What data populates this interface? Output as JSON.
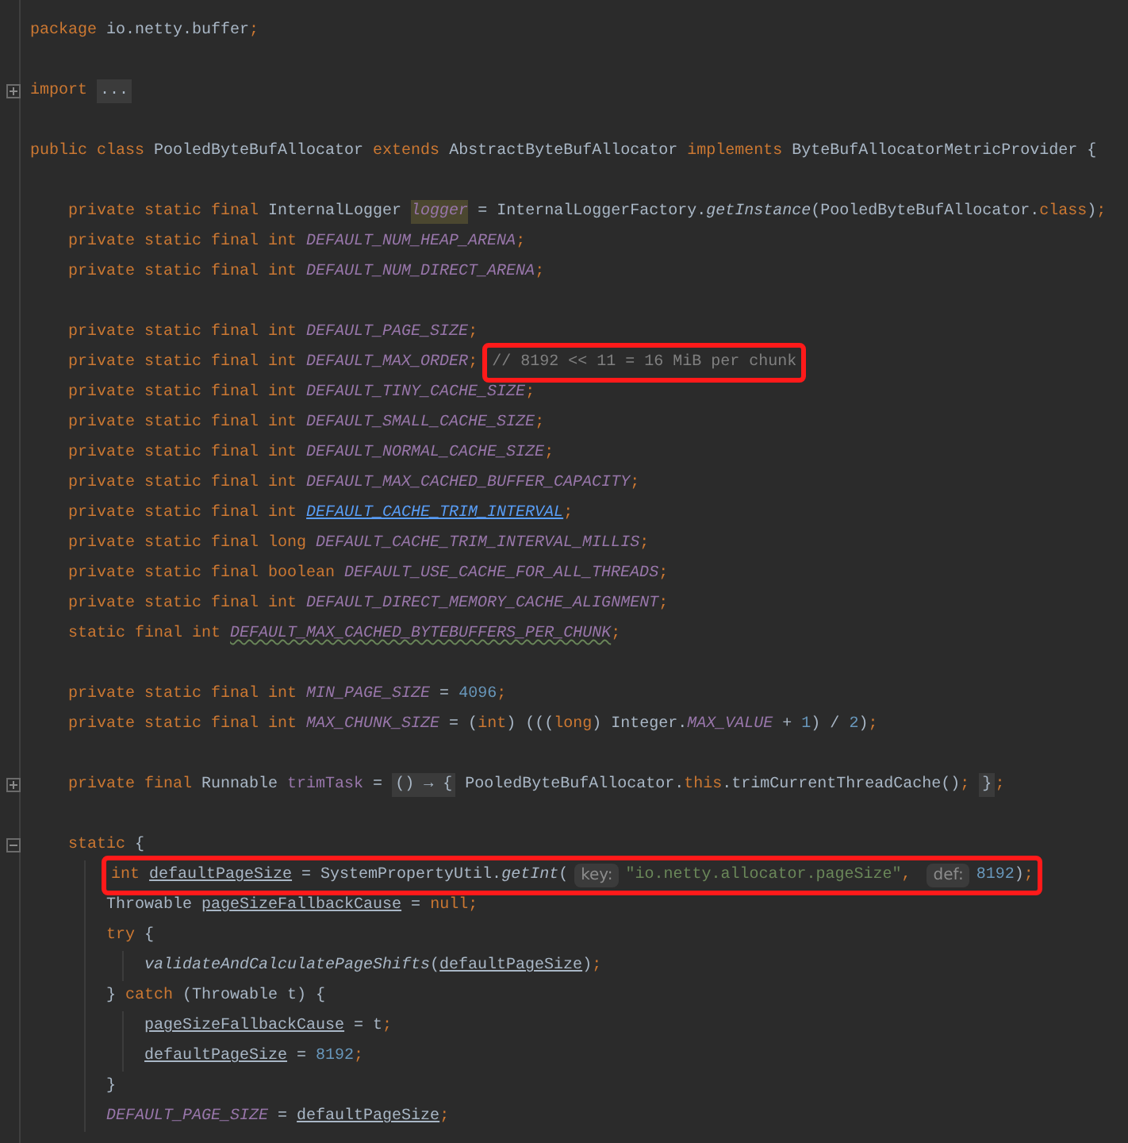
{
  "editor": {
    "lines": [
      {
        "kind": "code",
        "tokens": [
          {
            "kind": "kw",
            "text": "package "
          },
          {
            "kind": "plain",
            "text": "io.netty.buffer"
          },
          {
            "kind": "kw",
            "text": ";"
          }
        ]
      },
      {
        "kind": "blank"
      },
      {
        "kind": "code",
        "collapsed": true,
        "tokens": [
          {
            "kind": "kw",
            "text": "import "
          },
          {
            "kind": "folded",
            "text": "..."
          }
        ]
      },
      {
        "kind": "blank"
      },
      {
        "kind": "code",
        "tokens": [
          {
            "kind": "kw",
            "text": "public class "
          },
          {
            "kind": "plain",
            "text": "PooledByteBufAllocator "
          },
          {
            "kind": "kw",
            "text": "extends "
          },
          {
            "kind": "plain",
            "text": "AbstractByteBufAllocator "
          },
          {
            "kind": "kw",
            "text": "implements "
          },
          {
            "kind": "plain",
            "text": "ByteBufAllocatorMetricProvider {"
          }
        ],
        "children": [
          {
            "kind": "blank"
          },
          {
            "kind": "code",
            "tokens": [
              {
                "kind": "kw",
                "text": "private static final "
              },
              {
                "kind": "plain",
                "text": "InternalLogger "
              },
              {
                "kind": "marked",
                "text": "logger"
              },
              {
                "kind": "plain",
                "text": " = InternalLoggerFactory."
              },
              {
                "kind": "method",
                "text": "getInstance"
              },
              {
                "kind": "plain",
                "text": "(PooledByteBufAllocator."
              },
              {
                "kind": "kw",
                "text": "class"
              },
              {
                "kind": "plain",
                "text": ")"
              },
              {
                "kind": "kw",
                "text": ";"
              }
            ]
          },
          {
            "kind": "code",
            "tokens": [
              {
                "kind": "kw",
                "text": "private static final int "
              },
              {
                "kind": "const",
                "text": "DEFAULT_NUM_HEAP_ARENA"
              },
              {
                "kind": "kw",
                "text": ";"
              }
            ]
          },
          {
            "kind": "code",
            "tokens": [
              {
                "kind": "kw",
                "text": "private static final int "
              },
              {
                "kind": "const",
                "text": "DEFAULT_NUM_DIRECT_ARENA"
              },
              {
                "kind": "kw",
                "text": ";"
              }
            ]
          },
          {
            "kind": "blank"
          },
          {
            "kind": "code",
            "tokens": [
              {
                "kind": "kw",
                "text": "private static final int "
              },
              {
                "kind": "const",
                "text": "DEFAULT_PAGE_SIZE"
              },
              {
                "kind": "kw",
                "text": ";"
              }
            ]
          },
          {
            "kind": "code",
            "tokens": [
              {
                "kind": "kw",
                "text": "private static final int "
              },
              {
                "kind": "const",
                "text": "DEFAULT_MAX_ORDER"
              },
              {
                "kind": "kw",
                "text": "; "
              }
            ],
            "callout": [
              {
                "kind": "comment",
                "text": "// 8192 << 11 = 16 MiB per chunk"
              }
            ]
          },
          {
            "kind": "code",
            "tokens": [
              {
                "kind": "kw",
                "text": "private static final int "
              },
              {
                "kind": "const",
                "text": "DEFAULT_TINY_CACHE_SIZE"
              },
              {
                "kind": "kw",
                "text": ";"
              }
            ]
          },
          {
            "kind": "code",
            "tokens": [
              {
                "kind": "kw",
                "text": "private static final int "
              },
              {
                "kind": "const",
                "text": "DEFAULT_SMALL_CACHE_SIZE"
              },
              {
                "kind": "kw",
                "text": ";"
              }
            ]
          },
          {
            "kind": "code",
            "tokens": [
              {
                "kind": "kw",
                "text": "private static final int "
              },
              {
                "kind": "const",
                "text": "DEFAULT_NORMAL_CACHE_SIZE"
              },
              {
                "kind": "kw",
                "text": ";"
              }
            ]
          },
          {
            "kind": "code",
            "tokens": [
              {
                "kind": "kw",
                "text": "private static final int "
              },
              {
                "kind": "const",
                "text": "DEFAULT_MAX_CACHED_BUFFER_CAPACITY"
              },
              {
                "kind": "kw",
                "text": ";"
              }
            ]
          },
          {
            "kind": "code",
            "tokens": [
              {
                "kind": "kw",
                "text": "private static final int "
              },
              {
                "kind": "link",
                "text": "DEFAULT_CACHE_TRIM_INTERVAL"
              },
              {
                "kind": "kw",
                "text": ";"
              }
            ]
          },
          {
            "kind": "code",
            "tokens": [
              {
                "kind": "kw",
                "text": "private static final long "
              },
              {
                "kind": "const",
                "text": "DEFAULT_CACHE_TRIM_INTERVAL_MILLIS"
              },
              {
                "kind": "kw",
                "text": ";"
              }
            ]
          },
          {
            "kind": "code",
            "tokens": [
              {
                "kind": "kw",
                "text": "private static final boolean "
              },
              {
                "kind": "const",
                "text": "DEFAULT_USE_CACHE_FOR_ALL_THREADS"
              },
              {
                "kind": "kw",
                "text": ";"
              }
            ]
          },
          {
            "kind": "code",
            "tokens": [
              {
                "kind": "kw",
                "text": "private static final int "
              },
              {
                "kind": "const",
                "text": "DEFAULT_DIRECT_MEMORY_CACHE_ALIGNMENT"
              },
              {
                "kind": "kw",
                "text": ";"
              }
            ]
          },
          {
            "kind": "code",
            "tokens": [
              {
                "kind": "kw",
                "text": "static final int "
              },
              {
                "kind": "warn",
                "text": "DEFAULT_MAX_CACHED_BYTEBUFFERS_PER_CHUNK"
              },
              {
                "kind": "kw",
                "text": ";"
              }
            ]
          },
          {
            "kind": "blank"
          },
          {
            "kind": "code",
            "tokens": [
              {
                "kind": "kw",
                "text": "private static final int "
              },
              {
                "kind": "const",
                "text": "MIN_PAGE_SIZE"
              },
              {
                "kind": "plain",
                "text": " = "
              },
              {
                "kind": "num",
                "text": "4096"
              },
              {
                "kind": "kw",
                "text": ";"
              }
            ]
          },
          {
            "kind": "code",
            "tokens": [
              {
                "kind": "kw",
                "text": "private static final int "
              },
              {
                "kind": "const",
                "text": "MAX_CHUNK_SIZE"
              },
              {
                "kind": "plain",
                "text": " = ("
              },
              {
                "kind": "kw",
                "text": "int"
              },
              {
                "kind": "plain",
                "text": ") ((("
              },
              {
                "kind": "kw",
                "text": "long"
              },
              {
                "kind": "plain",
                "text": ") Integer."
              },
              {
                "kind": "const",
                "text": "MAX_VALUE"
              },
              {
                "kind": "plain",
                "text": " + "
              },
              {
                "kind": "num",
                "text": "1"
              },
              {
                "kind": "plain",
                "text": ") / "
              },
              {
                "kind": "num",
                "text": "2"
              },
              {
                "kind": "plain",
                "text": ")"
              },
              {
                "kind": "kw",
                "text": ";"
              }
            ]
          },
          {
            "kind": "blank"
          },
          {
            "kind": "code",
            "collapsed": true,
            "tokens": [
              {
                "kind": "kw",
                "text": "private final "
              },
              {
                "kind": "plain",
                "text": "Runnable "
              },
              {
                "kind": "field",
                "text": "trimTask"
              },
              {
                "kind": "plain",
                "text": " = "
              },
              {
                "kind": "folded",
                "text": "() → {"
              },
              {
                "kind": "plain",
                "text": " PooledByteBufAllocator."
              },
              {
                "kind": "kw",
                "text": "this"
              },
              {
                "kind": "plain",
                "text": ".trimCurrentThreadCache()"
              },
              {
                "kind": "kw",
                "text": "; "
              },
              {
                "kind": "folded",
                "text": "}"
              },
              {
                "kind": "kw",
                "text": ";"
              }
            ]
          },
          {
            "kind": "blank"
          },
          {
            "kind": "code",
            "collapsed": false,
            "tokens": [
              {
                "kind": "kw",
                "text": "static "
              },
              {
                "kind": "plain",
                "text": "{"
              }
            ],
            "children": [
              {
                "kind": "code",
                "callout": [
                  {
                    "kind": "kw",
                    "text": "int "
                  },
                  {
                    "kind": "local",
                    "text": "defaultPageSize"
                  },
                  {
                    "kind": "plain",
                    "text": " = SystemPropertyUtil."
                  },
                  {
                    "kind": "method",
                    "text": "getInt"
                  },
                  {
                    "kind": "plain",
                    "text": "("
                  },
                  {
                    "kind": "hint",
                    "text": "key:"
                  },
                  {
                    "kind": "str",
                    "text": "\"io.netty.allocator.pageSize\""
                  },
                  {
                    "kind": "kw",
                    "text": ", "
                  },
                  {
                    "kind": "hint",
                    "text": "def:"
                  },
                  {
                    "kind": "num",
                    "text": "8192"
                  },
                  {
                    "kind": "plain",
                    "text": ")"
                  },
                  {
                    "kind": "kw",
                    "text": ";"
                  }
                ]
              },
              {
                "kind": "code",
                "tokens": [
                  {
                    "kind": "plain",
                    "text": "Throwable "
                  },
                  {
                    "kind": "local",
                    "text": "pageSizeFallbackCause"
                  },
                  {
                    "kind": "plain",
                    "text": " = "
                  },
                  {
                    "kind": "kw",
                    "text": "null"
                  },
                  {
                    "kind": "kw",
                    "text": ";"
                  }
                ]
              },
              {
                "kind": "code",
                "tokens": [
                  {
                    "kind": "kw",
                    "text": "try "
                  },
                  {
                    "kind": "plain",
                    "text": "{"
                  }
                ],
                "children": [
                  {
                    "kind": "code",
                    "tokens": [
                      {
                        "kind": "method",
                        "text": "validateAndCalculatePageShifts"
                      },
                      {
                        "kind": "plain",
                        "text": "("
                      },
                      {
                        "kind": "local",
                        "text": "defaultPageSize"
                      },
                      {
                        "kind": "plain",
                        "text": ")"
                      },
                      {
                        "kind": "kw",
                        "text": ";"
                      }
                    ]
                  }
                ]
              },
              {
                "kind": "code",
                "tokens": [
                  {
                    "kind": "plain",
                    "text": "} "
                  },
                  {
                    "kind": "kw",
                    "text": "catch "
                  },
                  {
                    "kind": "plain",
                    "text": "(Throwable t) {"
                  }
                ],
                "children": [
                  {
                    "kind": "code",
                    "tokens": [
                      {
                        "kind": "local",
                        "text": "pageSizeFallbackCause"
                      },
                      {
                        "kind": "plain",
                        "text": " = t"
                      },
                      {
                        "kind": "kw",
                        "text": ";"
                      }
                    ]
                  },
                  {
                    "kind": "code",
                    "tokens": [
                      {
                        "kind": "local",
                        "text": "defaultPageSize"
                      },
                      {
                        "kind": "plain",
                        "text": " = "
                      },
                      {
                        "kind": "num",
                        "text": "8192"
                      },
                      {
                        "kind": "kw",
                        "text": ";"
                      }
                    ]
                  }
                ]
              },
              {
                "kind": "code",
                "tokens": [
                  {
                    "kind": "plain",
                    "text": "}"
                  }
                ]
              },
              {
                "kind": "code",
                "tokens": [
                  {
                    "kind": "const",
                    "text": "DEFAULT_PAGE_SIZE"
                  },
                  {
                    "kind": "plain",
                    "text": " = "
                  },
                  {
                    "kind": "local",
                    "text": "defaultPageSize"
                  },
                  {
                    "kind": "kw",
                    "text": ";"
                  }
                ]
              }
            ]
          }
        ]
      }
    ]
  }
}
